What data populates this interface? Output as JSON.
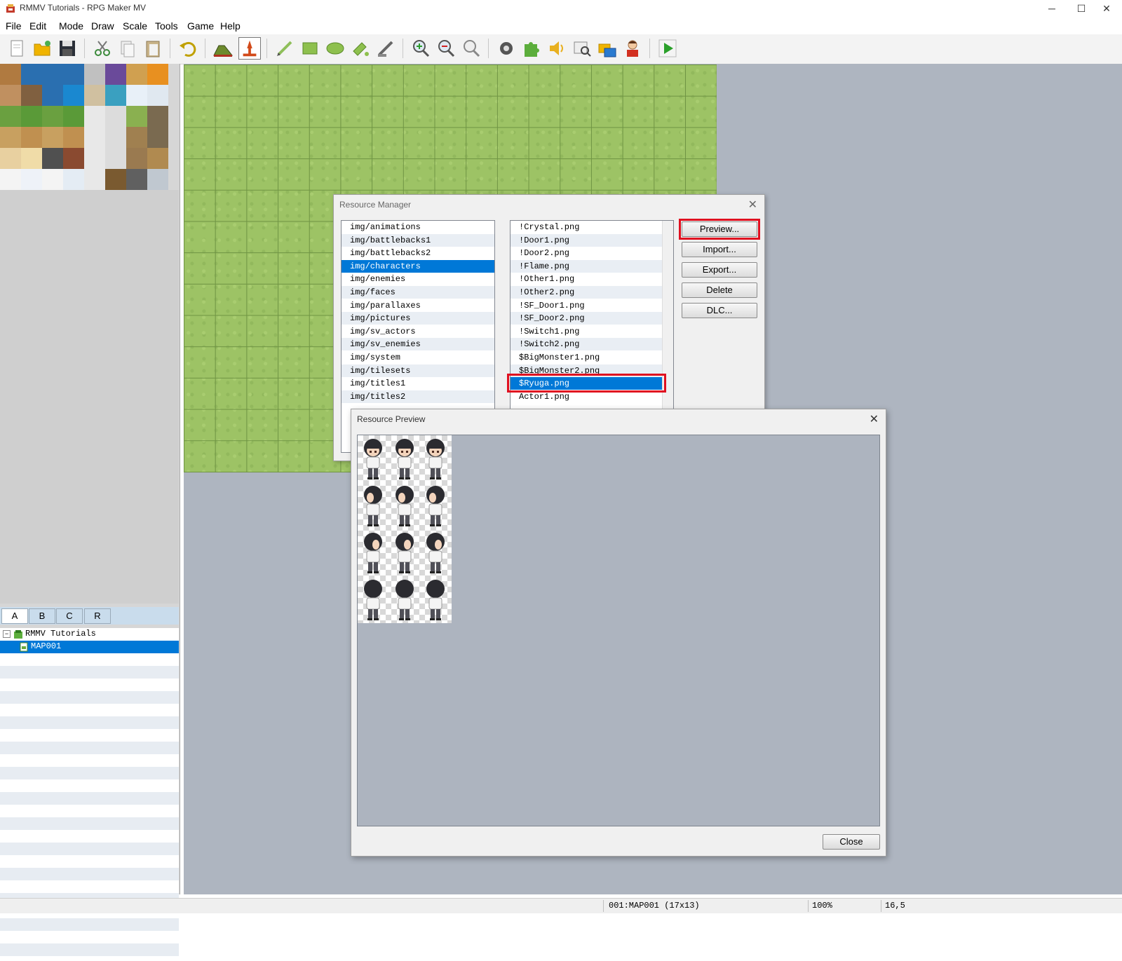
{
  "window": {
    "title": "RMMV Tutorials - RPG Maker MV",
    "minimize_glyph": "─",
    "maximize_glyph": "☐",
    "close_glyph": "✕"
  },
  "menu": [
    "File",
    "Edit",
    "Mode",
    "Draw",
    "Scale",
    "Tools",
    "Game",
    "Help"
  ],
  "toolbar": {
    "icons": [
      "new-project-icon",
      "open-project-icon",
      "save-project-icon",
      "cut-icon",
      "copy-icon",
      "paste-icon",
      "undo-icon",
      "map-mode-icon",
      "event-mode-icon",
      "pencil-icon",
      "rectangle-icon",
      "ellipse-icon",
      "fill-icon",
      "shadow-pen-icon",
      "zoom-in-icon",
      "zoom-out-icon",
      "actual-size-icon",
      "database-icon",
      "plugin-manager-icon",
      "sound-test-icon",
      "event-searcher-icon",
      "resource-manager-icon",
      "character-generator-icon",
      "playtest-icon"
    ]
  },
  "palette_tabs": [
    "A",
    "B",
    "C",
    "R"
  ],
  "map_tree": {
    "project": "RMMV Tutorials",
    "maps": [
      "MAP001"
    ]
  },
  "status": {
    "map": "001:MAP001 (17x13)",
    "zoom": "100%",
    "coords": "16,5"
  },
  "resource_manager": {
    "title": "Resource Manager",
    "close_glyph": "✕",
    "folders": [
      "img/animations",
      "img/battlebacks1",
      "img/battlebacks2",
      "img/characters",
      "img/enemies",
      "img/faces",
      "img/parallaxes",
      "img/pictures",
      "img/sv_actors",
      "img/sv_enemies",
      "img/system",
      "img/tilesets",
      "img/titles1",
      "img/titles2"
    ],
    "selected_folder": "img/characters",
    "files": [
      "!Crystal.png",
      "!Door1.png",
      "!Door2.png",
      "!Flame.png",
      "!Other1.png",
      "!Other2.png",
      "!SF_Door1.png",
      "!SF_Door2.png",
      "!Switch1.png",
      "!Switch2.png",
      "$BigMonster1.png",
      "$BigMonster2.png",
      "$Ryuga.png",
      "Actor1.png"
    ],
    "selected_file": "$Ryuga.png",
    "buttons": {
      "preview": "Preview...",
      "import": "Import...",
      "export": "Export...",
      "delete": "Delete",
      "dlc": "DLC..."
    }
  },
  "resource_preview": {
    "title": "Resource Preview",
    "close_glyph": "✕",
    "close_button": "Close"
  },
  "colors": {
    "highlight_red": "#e01020",
    "selection_blue": "#0078d7",
    "grass": "#9dc365",
    "map_background": "#aeb5c0"
  }
}
